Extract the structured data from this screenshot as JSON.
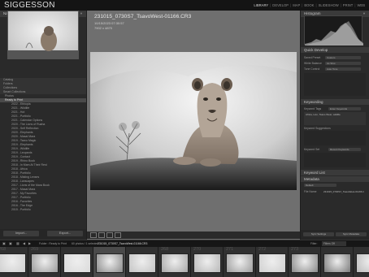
{
  "app": {
    "brand": "SIGGESSON",
    "modules": [
      "LIBRARY",
      "DEVELOP",
      "MAP",
      "BOOK",
      "SLIDESHOW",
      "PRINT",
      "WEB"
    ],
    "active_module": "LIBRARY"
  },
  "left_panel": {
    "navigator_title": "Navigator",
    "rows": [
      {
        "label": "Catalog",
        "count": ""
      },
      {
        "label": "Folders",
        "count": ""
      },
      {
        "label": "Collections",
        "count": ""
      },
      {
        "label": "Smart Collections",
        "count": ""
      },
      {
        "label": "Photos",
        "count": ""
      },
      {
        "label": "Ready to Print",
        "count": ""
      },
      {
        "label": "2022 - Ethiopia",
        "count": ""
      },
      {
        "label": "2021 - Wildlife",
        "count": ""
      },
      {
        "label": "2021 - Hot",
        "count": ""
      },
      {
        "label": "2021 - Portfolio",
        "count": ""
      },
      {
        "label": "2021 - Calendar Options",
        "count": ""
      },
      {
        "label": "2020 - The Lions of Ruaha",
        "count": ""
      },
      {
        "label": "2020 - Self Reflection",
        "count": ""
      },
      {
        "label": "2020 - Elephants",
        "count": ""
      },
      {
        "label": "2020 - Masai Mara",
        "count": ""
      },
      {
        "label": "2019 - Tsavo Magic",
        "count": ""
      },
      {
        "label": "2019 - Elephants",
        "count": ""
      },
      {
        "label": "2019 - Wildlife",
        "count": ""
      },
      {
        "label": "2019 - Leopards",
        "count": ""
      },
      {
        "label": "2019 - Contact",
        "count": ""
      },
      {
        "label": "2019 - Rhino Book",
        "count": ""
      },
      {
        "label": "2018 - In Mam At Their Rest",
        "count": ""
      },
      {
        "label": "2018 - Africa",
        "count": ""
      },
      {
        "label": "2018 - Portfolio",
        "count": ""
      },
      {
        "label": "2018 - Misting Lenses",
        "count": ""
      },
      {
        "label": "2018 - Lanscapes",
        "count": ""
      },
      {
        "label": "2017 - Lions of the Mara Book",
        "count": ""
      },
      {
        "label": "2017 - Masai Mara",
        "count": ""
      },
      {
        "label": "2017 - My Favorites",
        "count": ""
      },
      {
        "label": "2017 - Portfolio",
        "count": ""
      },
      {
        "label": "2016 - Favorites",
        "count": ""
      },
      {
        "label": "2016 - The Edge",
        "count": ""
      },
      {
        "label": "2015 - Portfolio",
        "count": ""
      }
    ],
    "import_button": "Import...",
    "export_button": "Export..."
  },
  "image_info": {
    "filename": "231015_0730S7_TsavoWest-01166.CR3",
    "datetime": "10/15/2023 07:30:57",
    "dimensions": "7902 x 4870"
  },
  "right_panel": {
    "histogram_title": "Histogram",
    "quick_develop_title": "Quick Develop",
    "saved_preset_label": "Saved Preset",
    "saved_preset_value": "Custom",
    "white_balance_label": "White Balance",
    "white_balance_value": "As Shot",
    "tone_control_label": "Tone Control",
    "tone_control_value": "Auto Tone",
    "keywording_title": "Keywording",
    "keyword_tags_label": "Keyword Tags",
    "keyword_tags_value": "Enter Keywords",
    "keywords_text": "Africa, Lion, Tsavo West, wildlife",
    "keyword_suggestions_label": "Keyword Suggestions",
    "keyword_set_label": "Keyword Set",
    "keyword_set_value": "Recent Keywords",
    "keyword_list_title": "Keyword List",
    "metadata_title": "Metadata",
    "metadata_preset": "Default",
    "file_name_label": "File Name",
    "file_name_value": "231015_0730S7_TsavoWest-01166.CR3",
    "sync_settings": "Sync Settings",
    "sync_metadata": "Sync Metadata"
  },
  "filmstrip": {
    "breadcrumb": "Folder : Ready to Print",
    "count_text": "60 photos / 1 selected",
    "current_file": "231015_0730S7_TsavoWest-01166.CR3",
    "filter_label": "Filter:",
    "filter_value": "Filters Off",
    "cells": [
      {
        "num": "268",
        "selected": false
      },
      {
        "num": "269",
        "selected": false
      },
      {
        "num": "",
        "selected": false
      },
      {
        "num": "",
        "selected": true
      },
      {
        "num": "",
        "selected": false
      },
      {
        "num": "268",
        "selected": false
      },
      {
        "num": "270",
        "selected": false
      },
      {
        "num": "271",
        "selected": false
      },
      {
        "num": "272",
        "selected": false
      },
      {
        "num": "273",
        "selected": false
      },
      {
        "num": "",
        "selected": false
      },
      {
        "num": "",
        "selected": false
      }
    ]
  }
}
